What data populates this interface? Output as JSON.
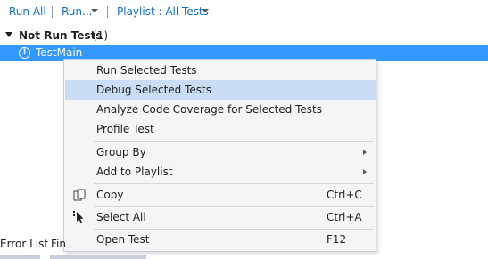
{
  "toolbar": {
    "run_all": "Run All",
    "run": "Run...",
    "playlist": "Playlist : All Tests"
  },
  "group": {
    "label": "Not Run Tests",
    "count": "(1)"
  },
  "test": {
    "label": "TestMain",
    "icon": "warning-icon"
  },
  "context_menu": {
    "items": [
      {
        "label": "Run Selected Tests"
      },
      {
        "label": "Debug Selected Tests",
        "highlighted": true
      },
      {
        "label": "Analyze Code Coverage for Selected Tests"
      },
      {
        "label": "Profile Test"
      },
      {
        "label": "Group By",
        "submenu": true
      },
      {
        "label": "Add to Playlist",
        "submenu": true
      },
      {
        "label": "Copy",
        "shortcut": "Ctrl+C",
        "icon": "copy-icon"
      },
      {
        "label": "Select All",
        "shortcut": "Ctrl+A",
        "icon": "select-all-icon"
      },
      {
        "label": "Open Test",
        "shortcut": "F12"
      }
    ]
  },
  "bottom_tabs": {
    "error_list": "Error List",
    "find": "Fin"
  },
  "colors": {
    "selection": "#3399ff",
    "menu_hover": "#c9def5",
    "link": "#0e70c0"
  }
}
